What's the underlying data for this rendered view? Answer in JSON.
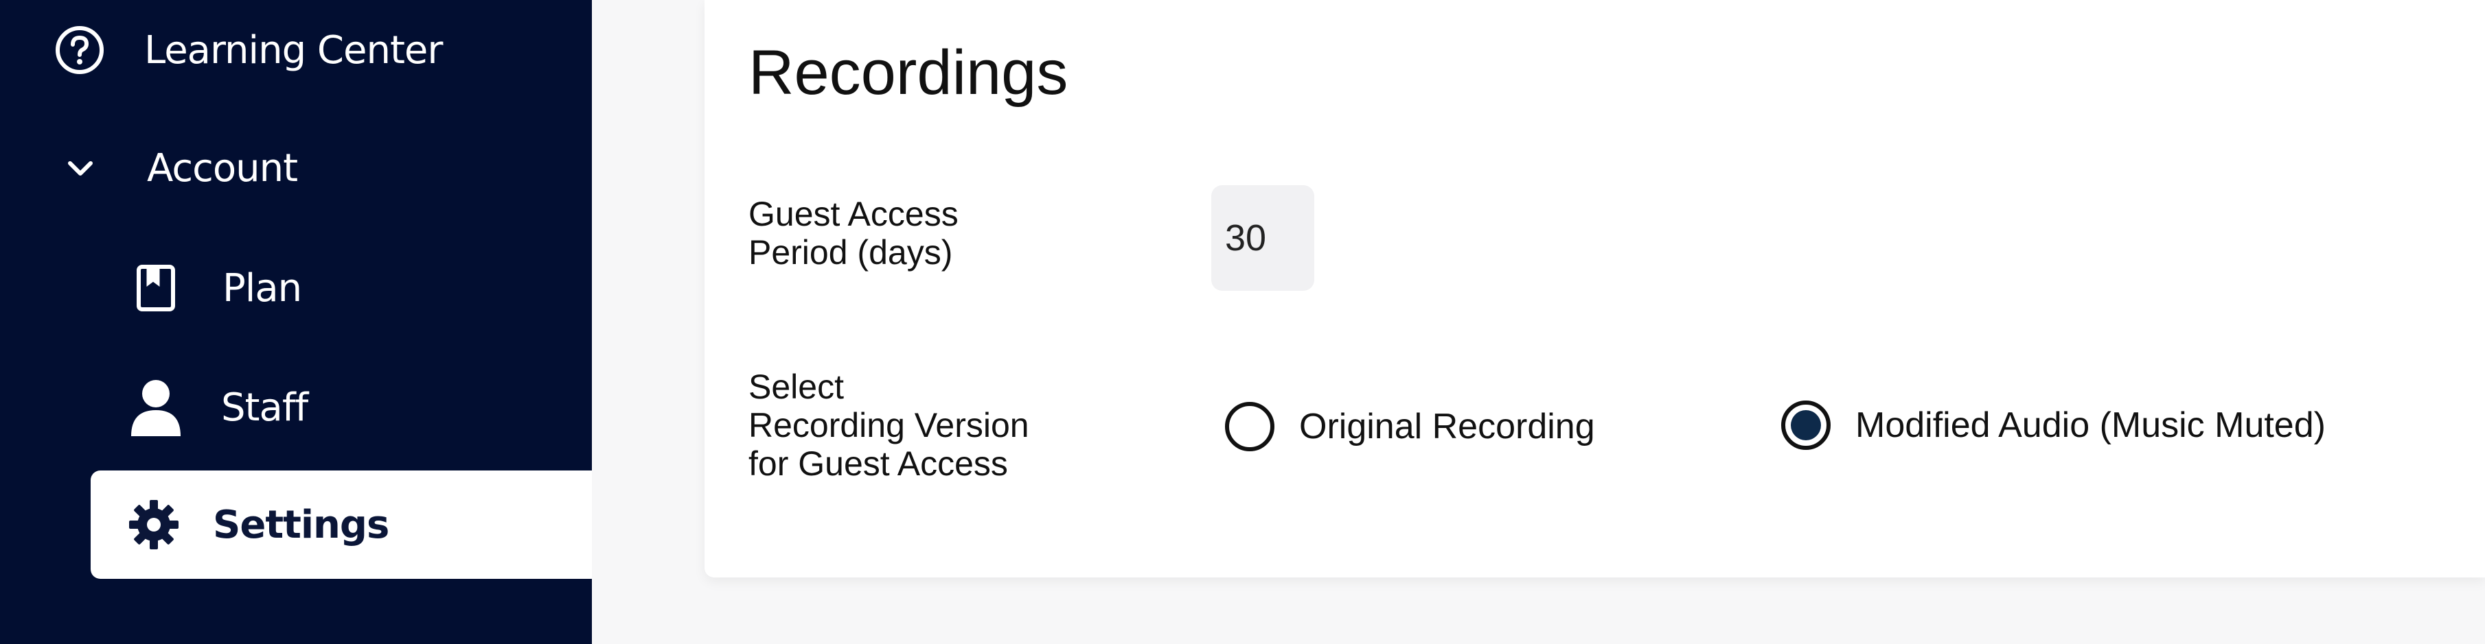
{
  "sidebar": {
    "items": [
      {
        "label": "Learning Center",
        "icon": "help-circle-icon"
      },
      {
        "label": "Account",
        "icon": "chevron-down-icon"
      },
      {
        "label": "Plan",
        "icon": "bookmark-book-icon"
      },
      {
        "label": "Staff",
        "icon": "person-icon"
      },
      {
        "label": "Settings",
        "icon": "gear-icon",
        "active": true
      }
    ]
  },
  "recordings": {
    "title": "Recordings",
    "guest_access_label": "Guest Access\nPeriod (days)",
    "guest_access_value": "30",
    "version_label": "Select\nRecording Version\nfor Guest Access",
    "options": [
      {
        "label": "Original Recording",
        "selected": false
      },
      {
        "label": "Modified Audio (Music Muted)",
        "selected": true
      }
    ]
  },
  "colors": {
    "sidebar_bg": "#020e31",
    "radio_selected": "#0e2a4a"
  }
}
